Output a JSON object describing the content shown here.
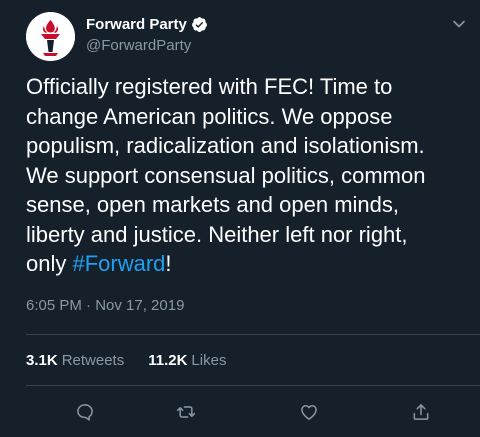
{
  "author": {
    "display_name": "Forward Party",
    "handle": "@ForwardParty",
    "verified": true,
    "avatar": "torch-logo"
  },
  "tweet": {
    "lines": [
      "Officially registered with FEC! Time to",
      "change American politics. We oppose",
      "populism, radicalization and isolationism.",
      "We support consensual politics, common",
      "sense, open markets and open minds,",
      "liberty and justice. Neither left nor right,"
    ],
    "last_line_prefix": "only ",
    "hashtag": "#Forward",
    "last_line_suffix": "!"
  },
  "timestamp": "6:05 PM · Nov 17, 2019",
  "stats": {
    "retweets_count": "3.1K",
    "retweets_label": "Retweets",
    "likes_count": "11.2K",
    "likes_label": "Likes"
  },
  "actions": [
    "reply-icon",
    "retweet-icon",
    "like-icon",
    "share-icon"
  ],
  "colors": {
    "background": "#15202b",
    "text": "#ffffff",
    "muted": "#8899a6",
    "accent": "#1da1f2",
    "divider": "#38444d",
    "logo_red": "#c8102e"
  }
}
